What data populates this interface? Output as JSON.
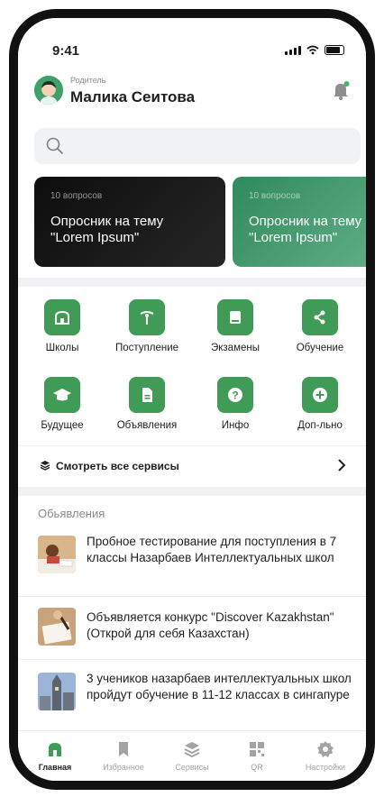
{
  "status": {
    "time": "9:41"
  },
  "header": {
    "role": "Родитель",
    "name": "Малика Сеитова"
  },
  "cards": [
    {
      "subtitle": "10 вопросов",
      "title_line1": "Опросник на тему",
      "title_line2": "\"Lorem Ipsum\""
    },
    {
      "subtitle": "10 вопросов",
      "title_line1": "Опросник на тему",
      "title_line2": "\"Lorem Ipsum\""
    }
  ],
  "services": [
    {
      "label": "Школы",
      "icon": "school-icon"
    },
    {
      "label": "Поступление",
      "icon": "admission-icon"
    },
    {
      "label": "Экзамены",
      "icon": "exam-icon"
    },
    {
      "label": "Обучение",
      "icon": "share-icon"
    },
    {
      "label": "Будущее",
      "icon": "graduation-cap-icon"
    },
    {
      "label": "Объявления",
      "icon": "document-icon"
    },
    {
      "label": "Инфо",
      "icon": "question-icon"
    },
    {
      "label": "Доп-льно",
      "icon": "plus-icon"
    }
  ],
  "see_all": {
    "label": "Смотреть все сервисы"
  },
  "announcements": {
    "title": "Обьявления",
    "items": [
      {
        "text": "Пробное тестирование для поступления в 7 классы Назарбаев Интеллектуальных школ"
      },
      {
        "text": "Объявляется конкурс \"Discover Kazakhstan\" (Открой для себя Казахстан)"
      },
      {
        "text": "3 учеников назарбаев интеллектуальных школ пройдут обучение в 11-12 классах в сингапуре"
      }
    ]
  },
  "tabs": [
    {
      "label": "Главная",
      "icon": "home-icon",
      "active": true
    },
    {
      "label": "Избранное",
      "icon": "bookmark-icon",
      "active": false
    },
    {
      "label": "Сервисы",
      "icon": "layers-icon",
      "active": false
    },
    {
      "label": "QR",
      "icon": "qr-icon",
      "active": false
    },
    {
      "label": "Настройки",
      "icon": "gear-icon",
      "active": false
    }
  ],
  "colors": {
    "accent": "#3f9b55",
    "inactive": "#a3a3a3",
    "card_green": "#4fa575"
  }
}
